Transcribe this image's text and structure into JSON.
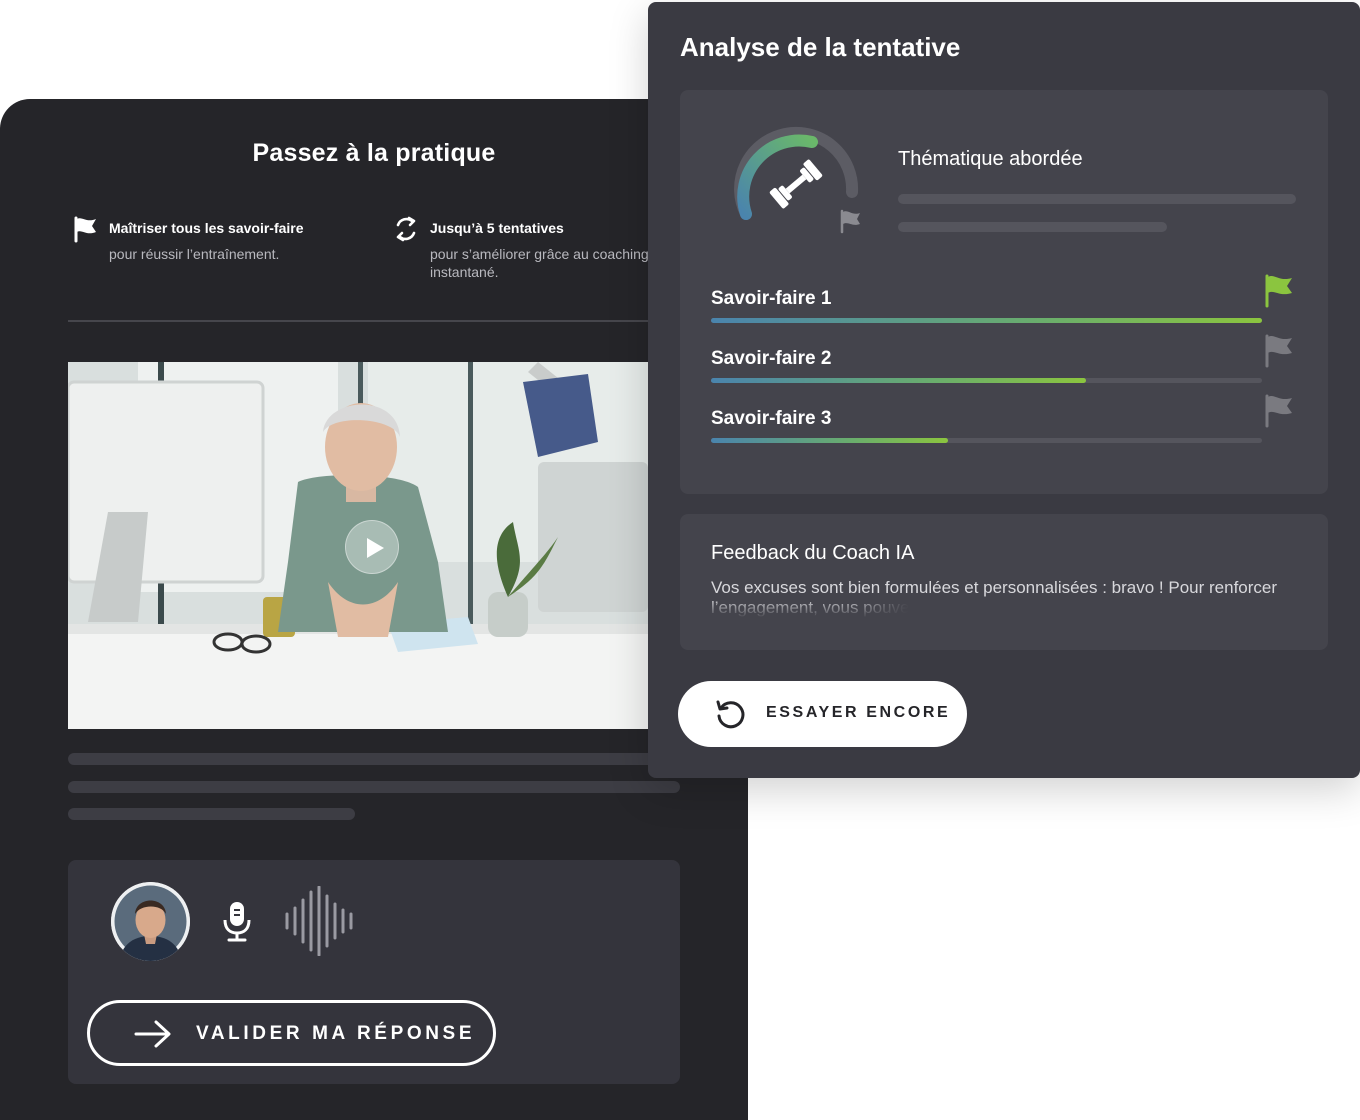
{
  "practice": {
    "title": "Passez à la pratique",
    "features": [
      {
        "icon": "flag-icon",
        "heading": "Maîtriser tous les savoir-faire",
        "body": "pour réussir l’entraînement."
      },
      {
        "icon": "retry-cycle-icon",
        "heading": "Jusqu’à 5 tentatives",
        "body": "pour s’améliorer grâce au coaching instantané."
      }
    ],
    "video": {
      "icon": "play-icon"
    },
    "recorder": {
      "avatar_icon": "user-avatar",
      "mic_icon": "microphone-icon",
      "wave_icon": "audio-waveform-icon",
      "validate_label": "VALIDER MA RÉPONSE"
    }
  },
  "analysis": {
    "title": "Analyse de la tentative",
    "theme_label": "Thématique abordée",
    "gauge_icon": "dumbbell-icon",
    "skills": [
      {
        "name": "Savoir-faire 1",
        "progress": 1.0,
        "flag_color": "#8bc53f"
      },
      {
        "name": "Savoir-faire 2",
        "progress": 0.68,
        "flag_color": "#7a7a80"
      },
      {
        "name": "Savoir-faire 3",
        "progress": 0.43,
        "flag_color": "#7a7a80"
      }
    ],
    "feedback": {
      "title": "Feedback du Coach IA",
      "text_main": "Vos excuses sont bien formulées et personnalisées : bravo ! Pour renforcer l’engagement, ",
      "text_fade": "vous pouve"
    },
    "retry_label": "ESSAYER ENCORE"
  },
  "colors": {
    "dark_bg": "#252529",
    "panel_bg": "#3a3a42",
    "accent_green": "#8bc53f",
    "accent_blue": "#4a84ad"
  }
}
